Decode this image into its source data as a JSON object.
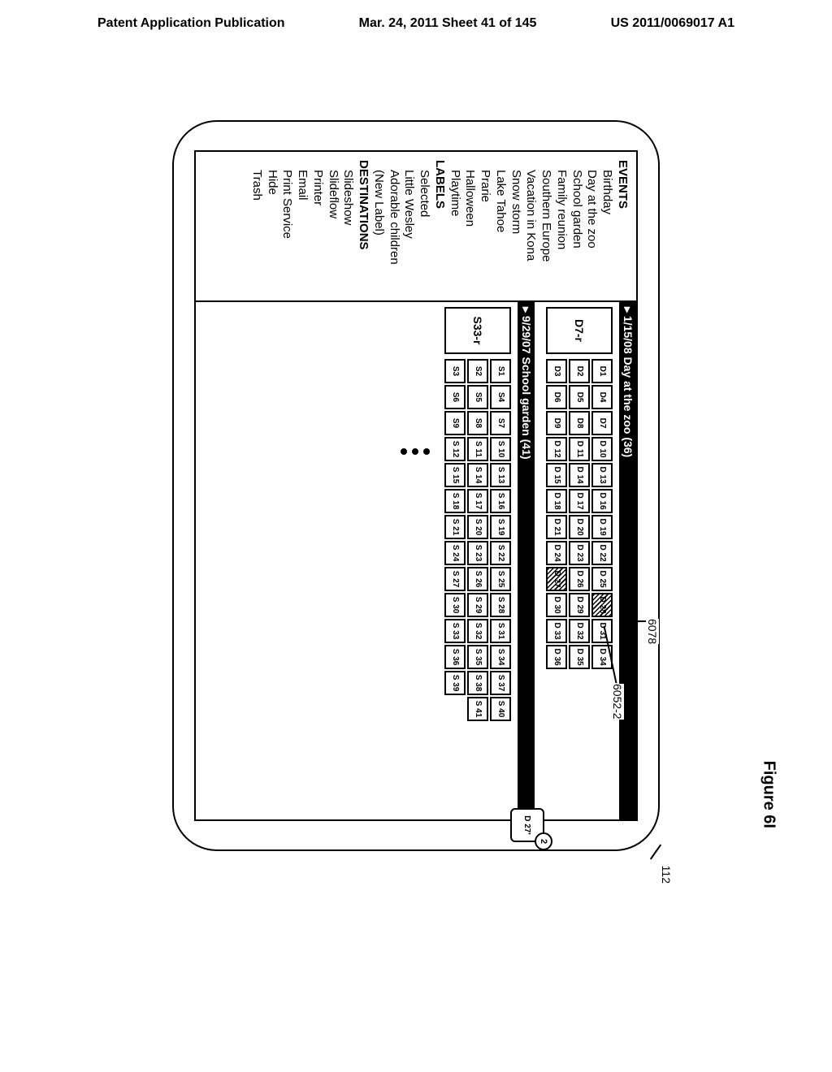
{
  "header": {
    "left": "Patent Application Publication",
    "center": "Mar. 24, 2011  Sheet 41 of 145",
    "right": "US 2011/0069017 A1"
  },
  "callouts": {
    "device": "112",
    "header1": "6078",
    "cell28": "6052-2",
    "badge": "2",
    "drag": "D 27'"
  },
  "sidebar": {
    "events": {
      "heading": "EVENTS",
      "items": [
        "Birthday",
        "Day at the zoo",
        "School garden",
        "Family reunion",
        "Southern Europe",
        "Vacation in Kona",
        "Snow storm",
        "Lake Tahoe",
        "Prarie",
        "Halloween",
        "Playtime"
      ]
    },
    "labels": {
      "heading": "LABELS",
      "items": [
        "Selected",
        "Little Wesley",
        "Adorable children",
        "(New Label)"
      ]
    },
    "destinations": {
      "heading": "DESTINATIONS",
      "items": [
        "Slideshow",
        "Slideflow",
        "Printer",
        "Email",
        "Print Service",
        "Hide",
        "Trash"
      ]
    }
  },
  "album1": {
    "header": "1/15/08 Day at the zoo (36)",
    "rep": "D7-r",
    "rows": [
      [
        {
          "t": "D1"
        },
        {
          "t": "D4"
        },
        {
          "t": "D7"
        },
        {
          "t": "D 10"
        },
        {
          "t": "D 13"
        },
        {
          "t": "D 16"
        },
        {
          "t": "D 19"
        },
        {
          "t": "D 22"
        },
        {
          "t": "D 25"
        },
        {
          "t": "D 28",
          "h": true
        },
        {
          "t": "D 31"
        },
        {
          "t": "D 34"
        }
      ],
      [
        {
          "t": "D2"
        },
        {
          "t": "D5"
        },
        {
          "t": "D8"
        },
        {
          "t": "D 11"
        },
        {
          "t": "D 14"
        },
        {
          "t": "D 17"
        },
        {
          "t": "D 20"
        },
        {
          "t": "D 23"
        },
        {
          "t": "D 26"
        },
        {
          "t": "D 29"
        },
        {
          "t": "D 32"
        },
        {
          "t": "D 35"
        }
      ],
      [
        {
          "t": "D3"
        },
        {
          "t": "D6"
        },
        {
          "t": "D9"
        },
        {
          "t": "D 12"
        },
        {
          "t": "D 15"
        },
        {
          "t": "D 18"
        },
        {
          "t": "D 21"
        },
        {
          "t": "D 24"
        },
        {
          "t": "D 27",
          "h": true
        },
        {
          "t": "D 30"
        },
        {
          "t": "D 33"
        },
        {
          "t": "D 36"
        }
      ]
    ]
  },
  "album2": {
    "header": "9/29/07 School garden (41)",
    "rep": "S33-r",
    "rows": [
      [
        {
          "t": "S1"
        },
        {
          "t": "S4"
        },
        {
          "t": "S7"
        },
        {
          "t": "S 10"
        },
        {
          "t": "S 13"
        },
        {
          "t": "S 16"
        },
        {
          "t": "S 19"
        },
        {
          "t": "S 22"
        },
        {
          "t": "S 25"
        },
        {
          "t": "S 28"
        },
        {
          "t": "S 31"
        },
        {
          "t": "S 34"
        },
        {
          "t": "S 37"
        },
        {
          "t": "S 40"
        }
      ],
      [
        {
          "t": "S2"
        },
        {
          "t": "S5"
        },
        {
          "t": "S8"
        },
        {
          "t": "S 11"
        },
        {
          "t": "S 14"
        },
        {
          "t": "S 17"
        },
        {
          "t": "S 20"
        },
        {
          "t": "S 23"
        },
        {
          "t": "S 26"
        },
        {
          "t": "S 29"
        },
        {
          "t": "S 32"
        },
        {
          "t": "S 35"
        },
        {
          "t": "S 38"
        },
        {
          "t": "S 41"
        }
      ],
      [
        {
          "t": "S3"
        },
        {
          "t": "S6"
        },
        {
          "t": "S9"
        },
        {
          "t": "S 12"
        },
        {
          "t": "S 15"
        },
        {
          "t": "S 18"
        },
        {
          "t": "S 21"
        },
        {
          "t": "S 24"
        },
        {
          "t": "S 27"
        },
        {
          "t": "S 30"
        },
        {
          "t": "S 33"
        },
        {
          "t": "S 36"
        },
        {
          "t": "S 39"
        },
        {
          "t": "",
          "nb": true
        }
      ]
    ]
  },
  "figure_label": "Figure 6I"
}
